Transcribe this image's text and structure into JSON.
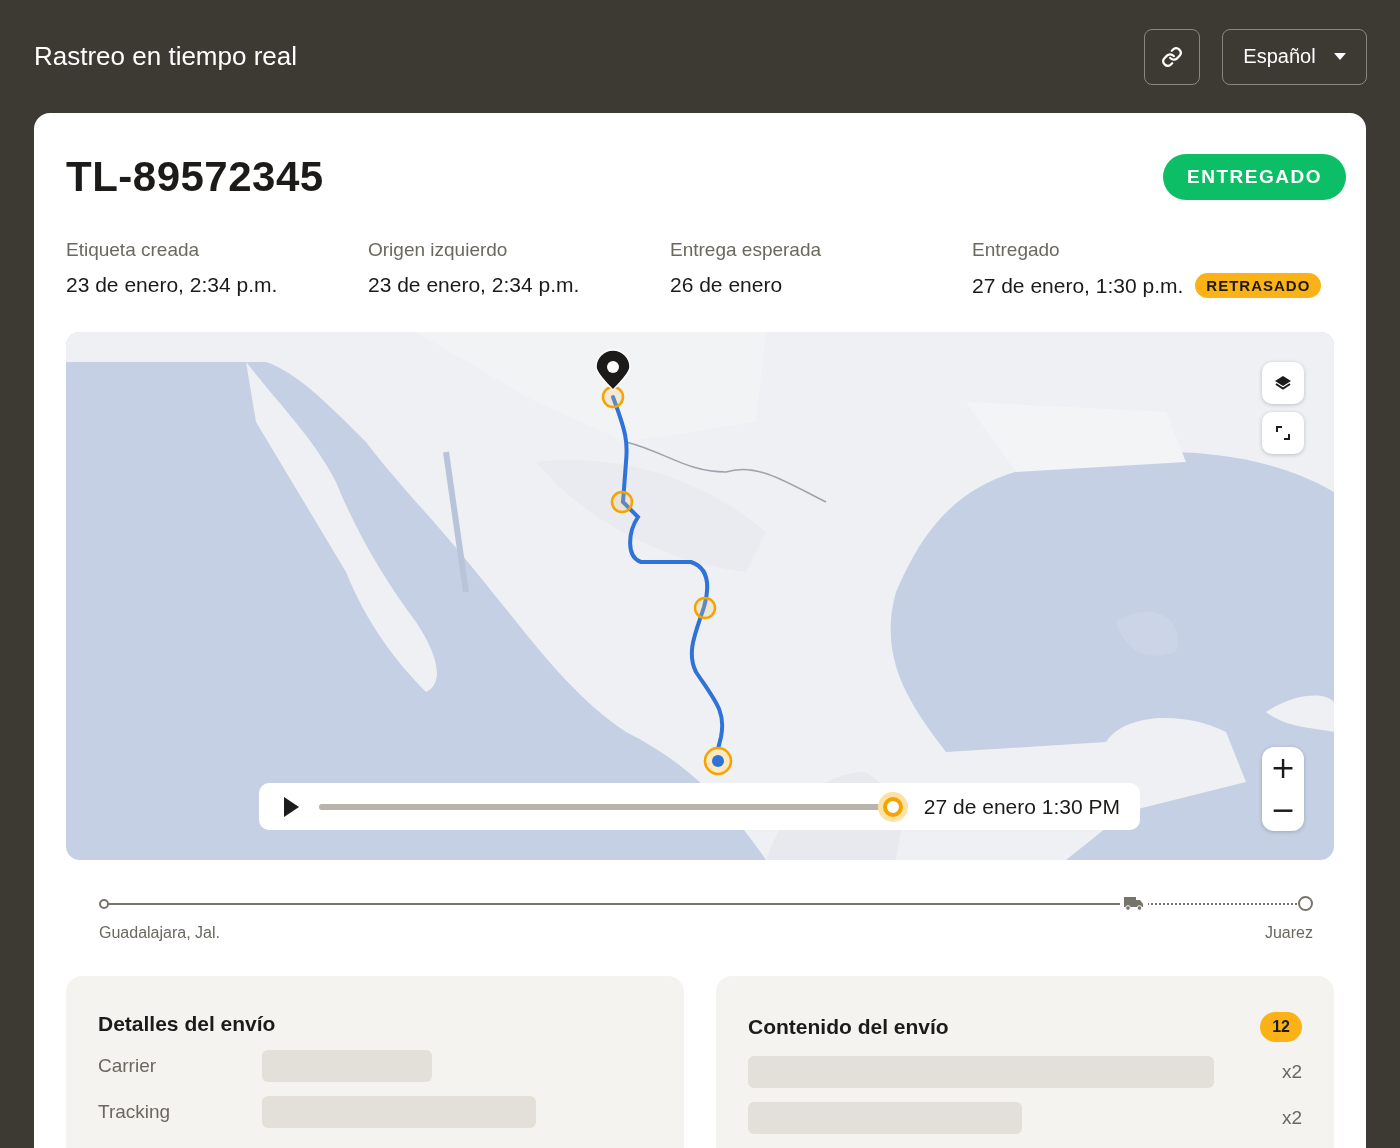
{
  "header": {
    "title": "Rastreo en tiempo real",
    "language": "Español"
  },
  "shipment": {
    "tracking_number": "TL-89572345",
    "status": "ENTREGADO"
  },
  "milestones": [
    {
      "label": "Etiqueta creada",
      "value": "23 de enero, 2:34 p.m."
    },
    {
      "label": "Origen izquierdo",
      "value": "23 de enero, 2:34 p.m."
    },
    {
      "label": "Entrega esperada",
      "value": "26 de enero"
    },
    {
      "label": "Entregado",
      "value": "27 de enero, 1:30 p.m.",
      "badge": "RETRASADO"
    }
  ],
  "map": {
    "kind": "picture",
    "playback": {
      "level": 1,
      "time": "27 de enero 1:30 PM"
    },
    "zoom_in": "+",
    "zoom_out": "−"
  },
  "progress": {
    "origin": "Guadalajara, Jal.",
    "destination": "Juarez",
    "level": 0.85
  },
  "details": {
    "title": "Detalles del envío",
    "rows": [
      {
        "label": "Carrier"
      },
      {
        "label": "Tracking"
      }
    ]
  },
  "contents": {
    "title": "Contenido del envío",
    "count": "12",
    "items": [
      {
        "quantity": "x2"
      },
      {
        "quantity": "x2"
      }
    ]
  }
}
